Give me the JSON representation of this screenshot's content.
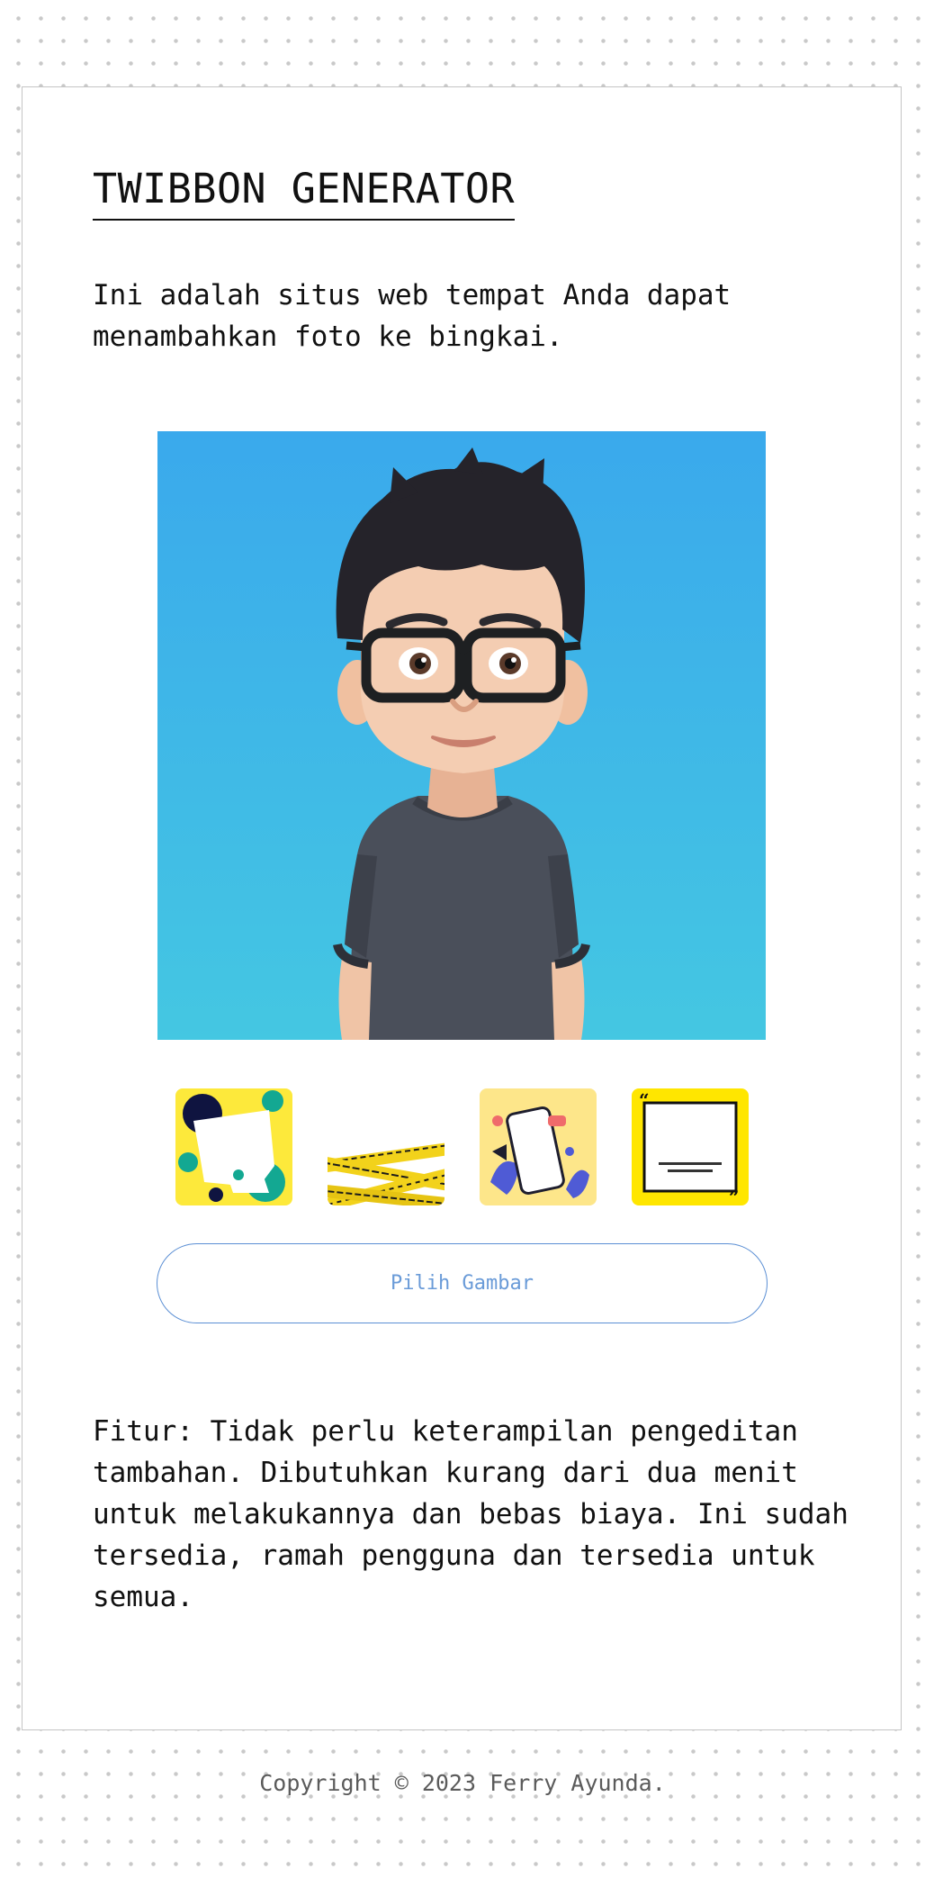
{
  "page": {
    "title": "TWIBBON GENERATOR",
    "intro": "Ini adalah situs web tempat Anda dapat menambahkan foto ke bingkai."
  },
  "preview": {
    "image": "avatar-man-with-glasses-icon",
    "background_colors": [
      "#3aa9ec",
      "#44c7e2"
    ]
  },
  "frames": [
    {
      "name": "frame-yellow-geometric",
      "color": "#fde93b"
    },
    {
      "name": "frame-warning-tape",
      "color": "#f2d21b"
    },
    {
      "name": "frame-smartphone-promo",
      "color": "#fde68a"
    },
    {
      "name": "frame-quote-yellow",
      "color": "#ffe600"
    }
  ],
  "actions": {
    "pick_image_label": "Pilih Gambar"
  },
  "features": {
    "text": "Fitur: Tidak perlu keterampilan pengeditan tambahan. Dibutuhkan kurang dari dua menit untuk melakukannya dan bebas biaya. Ini sudah tersedia, ramah pengguna dan tersedia untuk semua."
  },
  "footer": {
    "copyright": "Copyright © 2023 Ferry Ayunda."
  },
  "colors": {
    "accent": "#5b8fd4",
    "text": "#111111",
    "card_border": "#c4c4c4"
  }
}
